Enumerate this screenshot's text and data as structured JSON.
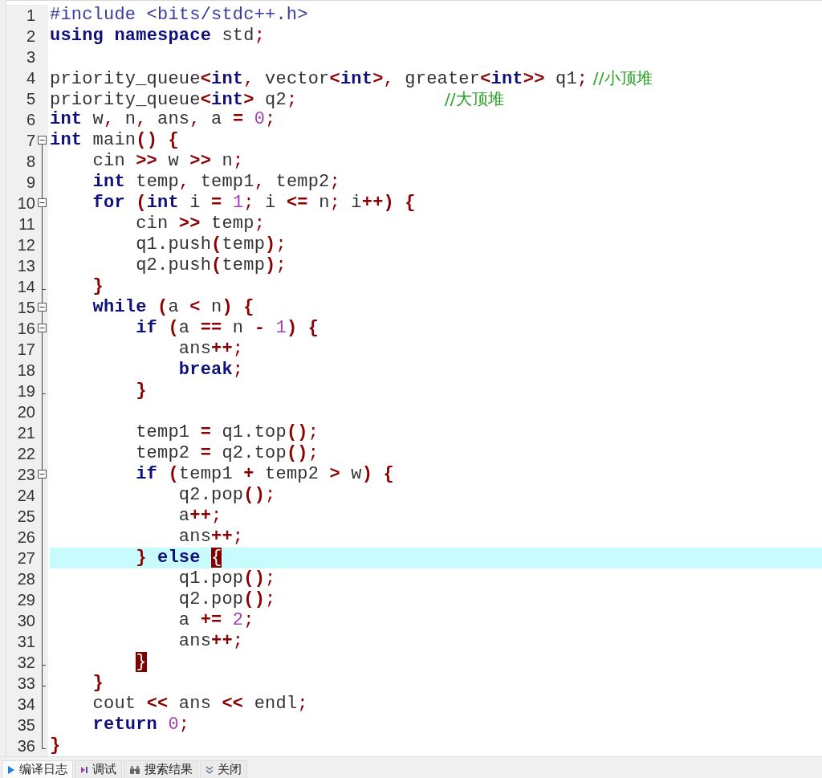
{
  "editor": {
    "lines": [
      {
        "number": "1",
        "fold_start": false,
        "in_fold": false,
        "fold_end": false,
        "current": false,
        "tokens": [
          {
            "kind": "pre",
            "text": "#include <bits/stdc++.h>"
          }
        ]
      },
      {
        "number": "2",
        "fold_start": false,
        "in_fold": false,
        "fold_end": false,
        "current": false,
        "tokens": [
          {
            "kind": "kw",
            "text": "using "
          },
          {
            "kind": "kw",
            "text": "namespace"
          },
          {
            "kind": "text",
            "text": " std"
          },
          {
            "kind": "punct",
            "text": ";"
          }
        ]
      },
      {
        "number": "3",
        "fold_start": false,
        "in_fold": false,
        "fold_end": false,
        "current": false
      },
      {
        "number": "4",
        "fold_start": false,
        "in_fold": false,
        "fold_end": false,
        "current": false,
        "tokens": [
          {
            "kind": "text",
            "text": "priority_queue"
          },
          {
            "kind": "sym",
            "text": "<"
          },
          {
            "kind": "kw",
            "text": "int"
          },
          {
            "kind": "punct",
            "text": ","
          },
          {
            "kind": "text",
            "text": " vector"
          },
          {
            "kind": "sym",
            "text": "<"
          },
          {
            "kind": "kw",
            "text": "int"
          },
          {
            "kind": "sym",
            "text": ">"
          },
          {
            "kind": "punct",
            "text": ","
          },
          {
            "kind": "text",
            "text": " greater"
          },
          {
            "kind": "sym",
            "text": "<"
          },
          {
            "kind": "kw",
            "text": "int"
          },
          {
            "kind": "sym",
            "text": ">>"
          },
          {
            "kind": "text",
            "text": " q1"
          },
          {
            "kind": "punct",
            "text": ";"
          },
          {
            "kind": "comment",
            "text": " //小顶堆"
          }
        ]
      },
      {
        "number": "5",
        "fold_start": false,
        "in_fold": false,
        "fold_end": false,
        "current": false,
        "tokens": [
          {
            "kind": "text",
            "text": "priority_queue"
          },
          {
            "kind": "sym",
            "text": "<"
          },
          {
            "kind": "kw",
            "text": "int"
          },
          {
            "kind": "sym",
            "text": ">"
          },
          {
            "kind": "text",
            "text": " q2"
          },
          {
            "kind": "punct",
            "text": ";"
          },
          {
            "kind": "comment",
            "text": "                            //大顶堆"
          }
        ]
      },
      {
        "number": "6",
        "fold_start": false,
        "in_fold": false,
        "fold_end": false,
        "current": false,
        "tokens": [
          {
            "kind": "kw",
            "text": "int"
          },
          {
            "kind": "text",
            "text": " w"
          },
          {
            "kind": "punct",
            "text": ","
          },
          {
            "kind": "text",
            "text": " n"
          },
          {
            "kind": "punct",
            "text": ","
          },
          {
            "kind": "text",
            "text": " ans"
          },
          {
            "kind": "punct",
            "text": ","
          },
          {
            "kind": "text",
            "text": " a "
          },
          {
            "kind": "sym",
            "text": "="
          },
          {
            "kind": "num",
            "text": " 0"
          },
          {
            "kind": "punct",
            "text": ";"
          }
        ]
      },
      {
        "number": "7",
        "fold_start": true,
        "in_fold": false,
        "fold_end": false,
        "current": false,
        "tokens": [
          {
            "kind": "kw",
            "text": "int"
          },
          {
            "kind": "text",
            "text": " main"
          },
          {
            "kind": "sym",
            "text": "() {"
          }
        ]
      },
      {
        "number": "8",
        "fold_start": false,
        "in_fold": true,
        "fold_end": false,
        "current": false,
        "tokens": [
          {
            "kind": "text",
            "text": "    cin "
          },
          {
            "kind": "sym",
            "text": ">>"
          },
          {
            "kind": "text",
            "text": " w "
          },
          {
            "kind": "sym",
            "text": ">>"
          },
          {
            "kind": "text",
            "text": " n"
          },
          {
            "kind": "punct",
            "text": ";"
          }
        ]
      },
      {
        "number": "9",
        "fold_start": false,
        "in_fold": true,
        "fold_end": false,
        "current": false,
        "tokens": [
          {
            "kind": "kw",
            "text": "    int"
          },
          {
            "kind": "text",
            "text": " temp"
          },
          {
            "kind": "punct",
            "text": ","
          },
          {
            "kind": "text",
            "text": " temp1"
          },
          {
            "kind": "punct",
            "text": ","
          },
          {
            "kind": "text",
            "text": " temp2"
          },
          {
            "kind": "punct",
            "text": ";"
          }
        ]
      },
      {
        "number": "10",
        "fold_start": true,
        "in_fold": true,
        "fold_end": false,
        "current": false,
        "tokens": [
          {
            "kind": "kw",
            "text": "    for"
          },
          {
            "kind": "sym",
            "text": " ("
          },
          {
            "kind": "kw",
            "text": "int"
          },
          {
            "kind": "text",
            "text": " i "
          },
          {
            "kind": "sym",
            "text": "="
          },
          {
            "kind": "num",
            "text": " 1"
          },
          {
            "kind": "punct",
            "text": ";"
          },
          {
            "kind": "text",
            "text": " i "
          },
          {
            "kind": "sym",
            "text": "<="
          },
          {
            "kind": "text",
            "text": " n"
          },
          {
            "kind": "punct",
            "text": ";"
          },
          {
            "kind": "text",
            "text": " i"
          },
          {
            "kind": "sym",
            "text": "++) {"
          }
        ]
      },
      {
        "number": "11",
        "fold_start": false,
        "in_fold": true,
        "fold_end": false,
        "current": false,
        "tokens": [
          {
            "kind": "text",
            "text": "        cin "
          },
          {
            "kind": "sym",
            "text": ">>"
          },
          {
            "kind": "text",
            "text": " temp"
          },
          {
            "kind": "punct",
            "text": ";"
          }
        ]
      },
      {
        "number": "12",
        "fold_start": false,
        "in_fold": true,
        "fold_end": false,
        "current": false,
        "tokens": [
          {
            "kind": "text",
            "text": "        q1.push"
          },
          {
            "kind": "sym",
            "text": "("
          },
          {
            "kind": "text",
            "text": "temp"
          },
          {
            "kind": "sym",
            "text": ")"
          },
          {
            "kind": "punct",
            "text": ";"
          }
        ]
      },
      {
        "number": "13",
        "fold_start": false,
        "in_fold": true,
        "fold_end": false,
        "current": false,
        "tokens": [
          {
            "kind": "text",
            "text": "        q2.push"
          },
          {
            "kind": "sym",
            "text": "("
          },
          {
            "kind": "text",
            "text": "temp"
          },
          {
            "kind": "sym",
            "text": ")"
          },
          {
            "kind": "punct",
            "text": ";"
          }
        ]
      },
      {
        "number": "14",
        "fold_start": false,
        "in_fold": true,
        "fold_end": true,
        "current": false,
        "tokens": [
          {
            "kind": "sym",
            "text": "    }"
          }
        ]
      },
      {
        "number": "15",
        "fold_start": true,
        "in_fold": true,
        "fold_end": false,
        "current": false,
        "tokens": [
          {
            "kind": "kw",
            "text": "    while"
          },
          {
            "kind": "sym",
            "text": " ("
          },
          {
            "kind": "text",
            "text": "a "
          },
          {
            "kind": "sym",
            "text": "<"
          },
          {
            "kind": "text",
            "text": " n"
          },
          {
            "kind": "sym",
            "text": ") {"
          }
        ]
      },
      {
        "number": "16",
        "fold_start": true,
        "in_fold": true,
        "fold_end": false,
        "current": false,
        "tokens": [
          {
            "kind": "kw",
            "text": "        if"
          },
          {
            "kind": "sym",
            "text": " ("
          },
          {
            "kind": "text",
            "text": "a "
          },
          {
            "kind": "sym",
            "text": "=="
          },
          {
            "kind": "text",
            "text": " n "
          },
          {
            "kind": "sym",
            "text": "-"
          },
          {
            "kind": "num",
            "text": " 1"
          },
          {
            "kind": "sym",
            "text": ") {"
          }
        ]
      },
      {
        "number": "17",
        "fold_start": false,
        "in_fold": true,
        "fold_end": false,
        "current": false,
        "tokens": [
          {
            "kind": "text",
            "text": "            ans"
          },
          {
            "kind": "sym",
            "text": "++"
          },
          {
            "kind": "punct",
            "text": ";"
          }
        ]
      },
      {
        "number": "18",
        "fold_start": false,
        "in_fold": true,
        "fold_end": false,
        "current": false,
        "tokens": [
          {
            "kind": "kw",
            "text": "            break"
          },
          {
            "kind": "punct",
            "text": ";"
          }
        ]
      },
      {
        "number": "19",
        "fold_start": false,
        "in_fold": true,
        "fold_end": true,
        "current": false,
        "tokens": [
          {
            "kind": "sym",
            "text": "        }"
          }
        ]
      },
      {
        "number": "20",
        "fold_start": false,
        "in_fold": true,
        "fold_end": false,
        "current": false
      },
      {
        "number": "21",
        "fold_start": false,
        "in_fold": true,
        "fold_end": false,
        "current": false,
        "tokens": [
          {
            "kind": "text",
            "text": "        temp1 "
          },
          {
            "kind": "sym",
            "text": "="
          },
          {
            "kind": "text",
            "text": " q1.top"
          },
          {
            "kind": "sym",
            "text": "()"
          },
          {
            "kind": "punct",
            "text": ";"
          }
        ]
      },
      {
        "number": "22",
        "fold_start": false,
        "in_fold": true,
        "fold_end": false,
        "current": false,
        "tokens": [
          {
            "kind": "text",
            "text": "        temp2 "
          },
          {
            "kind": "sym",
            "text": "="
          },
          {
            "kind": "text",
            "text": " q2.top"
          },
          {
            "kind": "sym",
            "text": "()"
          },
          {
            "kind": "punct",
            "text": ";"
          }
        ]
      },
      {
        "number": "23",
        "fold_start": true,
        "in_fold": true,
        "fold_end": false,
        "current": false,
        "tokens": [
          {
            "kind": "kw",
            "text": "        if"
          },
          {
            "kind": "sym",
            "text": " ("
          },
          {
            "kind": "text",
            "text": "temp1 "
          },
          {
            "kind": "sym",
            "text": "+"
          },
          {
            "kind": "text",
            "text": " temp2 "
          },
          {
            "kind": "sym",
            "text": ">"
          },
          {
            "kind": "text",
            "text": " w"
          },
          {
            "kind": "sym",
            "text": ") {"
          }
        ]
      },
      {
        "number": "24",
        "fold_start": false,
        "in_fold": true,
        "fold_end": false,
        "current": false,
        "tokens": [
          {
            "kind": "text",
            "text": "            q2.pop"
          },
          {
            "kind": "sym",
            "text": "()"
          },
          {
            "kind": "punct",
            "text": ";"
          }
        ]
      },
      {
        "number": "25",
        "fold_start": false,
        "in_fold": true,
        "fold_end": false,
        "current": false,
        "tokens": [
          {
            "kind": "text",
            "text": "            a"
          },
          {
            "kind": "sym",
            "text": "++"
          },
          {
            "kind": "punct",
            "text": ";"
          }
        ]
      },
      {
        "number": "26",
        "fold_start": false,
        "in_fold": true,
        "fold_end": false,
        "current": false,
        "tokens": [
          {
            "kind": "text",
            "text": "            ans"
          },
          {
            "kind": "sym",
            "text": "++"
          },
          {
            "kind": "punct",
            "text": ";"
          }
        ]
      },
      {
        "number": "27",
        "fold_start": false,
        "in_fold": true,
        "fold_end": false,
        "current": true,
        "tokens": [
          {
            "kind": "sym",
            "text": "        }"
          },
          {
            "kind": "kw",
            "text": " else"
          },
          {
            "kind": "match",
            "text": " {"
          }
        ]
      },
      {
        "number": "28",
        "fold_start": false,
        "in_fold": true,
        "fold_end": false,
        "current": false,
        "tokens": [
          {
            "kind": "text",
            "text": "            q1.pop"
          },
          {
            "kind": "sym",
            "text": "()"
          },
          {
            "kind": "punct",
            "text": ";"
          }
        ]
      },
      {
        "number": "29",
        "fold_start": false,
        "in_fold": true,
        "fold_end": false,
        "current": false,
        "tokens": [
          {
            "kind": "text",
            "text": "            q2.pop"
          },
          {
            "kind": "sym",
            "text": "()"
          },
          {
            "kind": "punct",
            "text": ";"
          }
        ]
      },
      {
        "number": "30",
        "fold_start": false,
        "in_fold": true,
        "fold_end": false,
        "current": false,
        "tokens": [
          {
            "kind": "text",
            "text": "            a "
          },
          {
            "kind": "sym",
            "text": "+="
          },
          {
            "kind": "num",
            "text": " 2"
          },
          {
            "kind": "punct",
            "text": ";"
          }
        ]
      },
      {
        "number": "31",
        "fold_start": false,
        "in_fold": true,
        "fold_end": false,
        "current": false,
        "tokens": [
          {
            "kind": "text",
            "text": "            ans"
          },
          {
            "kind": "sym",
            "text": "++"
          },
          {
            "kind": "punct",
            "text": ";"
          }
        ]
      },
      {
        "number": "32",
        "fold_start": false,
        "in_fold": true,
        "fold_end": true,
        "current": false,
        "tokens": [
          {
            "kind": "match",
            "text": "        }"
          }
        ]
      },
      {
        "number": "33",
        "fold_start": false,
        "in_fold": true,
        "fold_end": true,
        "current": false,
        "tokens": [
          {
            "kind": "sym",
            "text": "    }"
          }
        ]
      },
      {
        "number": "34",
        "fold_start": false,
        "in_fold": true,
        "fold_end": false,
        "current": false,
        "tokens": [
          {
            "kind": "text",
            "text": "    cout "
          },
          {
            "kind": "sym",
            "text": "<<"
          },
          {
            "kind": "text",
            "text": " ans "
          },
          {
            "kind": "sym",
            "text": "<<"
          },
          {
            "kind": "text",
            "text": " endl"
          },
          {
            "kind": "punct",
            "text": ";"
          }
        ]
      },
      {
        "number": "35",
        "fold_start": false,
        "in_fold": true,
        "fold_end": false,
        "current": false,
        "tokens": [
          {
            "kind": "kw",
            "text": "    return"
          },
          {
            "kind": "num",
            "text": " 0"
          },
          {
            "kind": "punct",
            "text": ";"
          }
        ]
      },
      {
        "number": "36",
        "fold_start": false,
        "in_fold": true,
        "fold_end": true,
        "current": false,
        "tokens": [
          {
            "kind": "sym",
            "text": "}"
          }
        ]
      }
    ]
  },
  "bottom_tabs": [
    {
      "kind": "compile-log",
      "label": "编译日志",
      "selected": true
    },
    {
      "kind": "debug",
      "label": "调试",
      "selected": false
    },
    {
      "kind": "search-results",
      "label": "搜索结果",
      "selected": false
    },
    {
      "kind": "close",
      "label": "关闭",
      "selected": false
    }
  ]
}
